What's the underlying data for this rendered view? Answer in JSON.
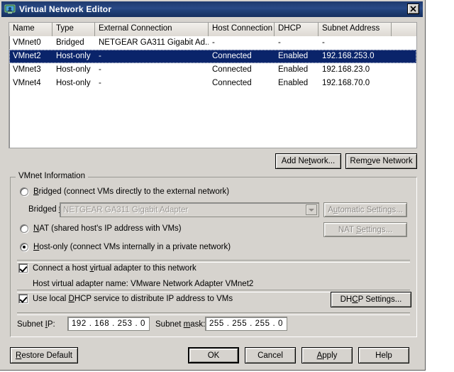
{
  "window": {
    "title": "Virtual Network Editor",
    "icon": "virtual-network-icon",
    "close_label": "✕"
  },
  "network_table": {
    "columns": [
      "Name",
      "Type",
      "External Connection",
      "Host Connection",
      "DHCP",
      "Subnet Address"
    ],
    "rows": [
      {
        "name": "VMnet0",
        "type": "Bridged",
        "external": "NETGEAR GA311 Gigabit Ad...",
        "host": "-",
        "dhcp": "-",
        "subnet": "-",
        "selected": false
      },
      {
        "name": "VMnet2",
        "type": "Host-only",
        "external": "-",
        "host": "Connected",
        "dhcp": "Enabled",
        "subnet": "192.168.253.0",
        "selected": true
      },
      {
        "name": "VMnet3",
        "type": "Host-only",
        "external": "-",
        "host": "Connected",
        "dhcp": "Enabled",
        "subnet": "192.168.23.0",
        "selected": false
      },
      {
        "name": "VMnet4",
        "type": "Host-only",
        "external": "-",
        "host": "Connected",
        "dhcp": "Enabled",
        "subnet": "192.168.70.0",
        "selected": false
      }
    ]
  },
  "table_buttons": {
    "add_network": "Add Network...",
    "remove_network": "Remove Network"
  },
  "vmnet_info": {
    "group_title": "VMnet Information",
    "bridged_label": "Bridged (connect VMs directly to the external network)",
    "bridged_selected": false,
    "bridged_to_label": "Bridged to:",
    "bridged_to_value": "NETGEAR GA311 Gigabit Adapter",
    "automatic_settings": "Automatic Settings...",
    "nat_label": "NAT (shared host's IP address with VMs)",
    "nat_selected": false,
    "nat_settings": "NAT Settings...",
    "hostonly_label": "Host-only (connect VMs internally in a private network)",
    "hostonly_selected": true,
    "connect_adapter_label": "Connect a host virtual adapter to this network",
    "connect_adapter_checked": true,
    "adapter_name_text": "Host virtual adapter name: VMware Network Adapter VMnet2",
    "dhcp_service_label": "Use local DHCP service to distribute IP address to VMs",
    "dhcp_service_checked": true,
    "dhcp_settings": "DHCP Settings...",
    "subnet_ip_label": "Subnet IP:",
    "subnet_ip_value": "192 . 168 . 253 .  0",
    "subnet_mask_label": "Subnet mask:",
    "subnet_mask_value": "255 . 255 . 255 .  0"
  },
  "footer": {
    "restore_default": "Restore Default",
    "ok": "OK",
    "cancel": "Cancel",
    "apply": "Apply",
    "help": "Help"
  },
  "colors": {
    "dialog_face": "#d6d3ce",
    "titlebar_blue": "#2a4a87",
    "selection_blue": "#0a246a",
    "disabled_text": "#8e8b87"
  }
}
